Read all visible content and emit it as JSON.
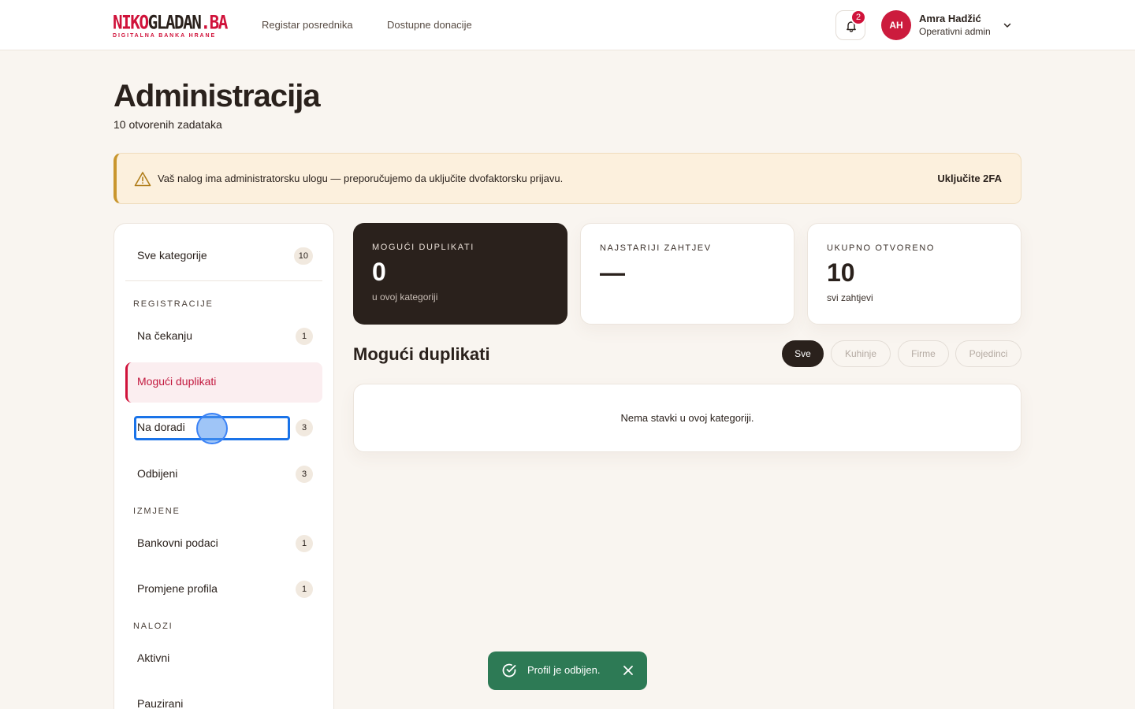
{
  "header": {
    "logo_red": "NIKO",
    "logo_dark": "GLADAN",
    "logo_domain": ".BA",
    "logo_tagline": "DIGITALNA BANKA HRANE",
    "nav": [
      "Registar posrednika",
      "Dostupne donacije"
    ],
    "notifications_count": "2",
    "user": {
      "initials": "AH",
      "name": "Amra Hadžić",
      "role": "Operativni admin"
    }
  },
  "page": {
    "title": "Administracija",
    "subtitle": "10 otvorenih zadataka"
  },
  "alert": {
    "text": "Vaš nalog ima administratorsku ulogu — preporučujemo da uključite dvofaktorsku prijavu.",
    "action": "Uključite 2FA"
  },
  "sidebar": {
    "all": {
      "label": "Sve kategorije",
      "count": "10"
    },
    "sections": [
      {
        "title": "REGISTRACIJE",
        "items": [
          {
            "label": "Na čekanju",
            "count": "1"
          },
          {
            "label": "Mogući duplikati",
            "count": ""
          },
          {
            "label": "Na doradi",
            "count": "3"
          },
          {
            "label": "Odbijeni",
            "count": "3"
          }
        ]
      },
      {
        "title": "IZMJENE",
        "items": [
          {
            "label": "Bankovni podaci",
            "count": "1"
          },
          {
            "label": "Promjene profila",
            "count": "1"
          }
        ]
      },
      {
        "title": "NALOZI",
        "items": [
          {
            "label": "Aktivni",
            "count": ""
          },
          {
            "label": "Pauzirani",
            "count": ""
          }
        ]
      }
    ]
  },
  "stats": [
    {
      "label": "MOGUĆI DUPLIKATI",
      "value": "0",
      "note": "u ovoj kategoriji"
    },
    {
      "label": "NAJSTARIJI ZAHTJEV",
      "value": "—",
      "note": ""
    },
    {
      "label": "UKUPNO OTVORENO",
      "value": "10",
      "note": "svi zahtjevi"
    }
  ],
  "list": {
    "title": "Mogući duplikati",
    "filters": [
      "Sve",
      "Kuhinje",
      "Firme",
      "Pojedinci"
    ],
    "active_filter": "Sve",
    "empty_text": "Nema stavki u ovoj kategoriji."
  },
  "toast": {
    "text": "Profil je odbijen."
  },
  "colors": {
    "brand_red": "#d0123a",
    "dark": "#2a211c",
    "toast_green": "#2d7a55",
    "alert_bg": "#fcf0dd",
    "alert_border": "#c9962e"
  }
}
